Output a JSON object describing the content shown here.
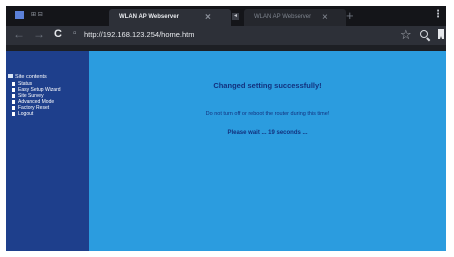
{
  "system": {
    "label": "⊞ ⊟"
  },
  "tabs": [
    {
      "title": "WLAN AP Webserver",
      "active": true
    },
    {
      "title": "WLAN AP Webserver",
      "active": false
    }
  ],
  "toolbar": {
    "url": "http://192.168.123.254/home.htm"
  },
  "sidebar": {
    "root_label": "Site contents",
    "items": [
      {
        "label": "Status"
      },
      {
        "label": "Easy Setup Wizard"
      },
      {
        "label": "Site Survey"
      },
      {
        "label": "Advanced Mode"
      },
      {
        "label": "Factory Reset"
      },
      {
        "label": "Logout"
      }
    ]
  },
  "main": {
    "headline": "Changed setting successfully!",
    "warning": "Do not turn off or reboot the router during this time!",
    "wait_text": "Please wait ... 19 seconds ..."
  }
}
